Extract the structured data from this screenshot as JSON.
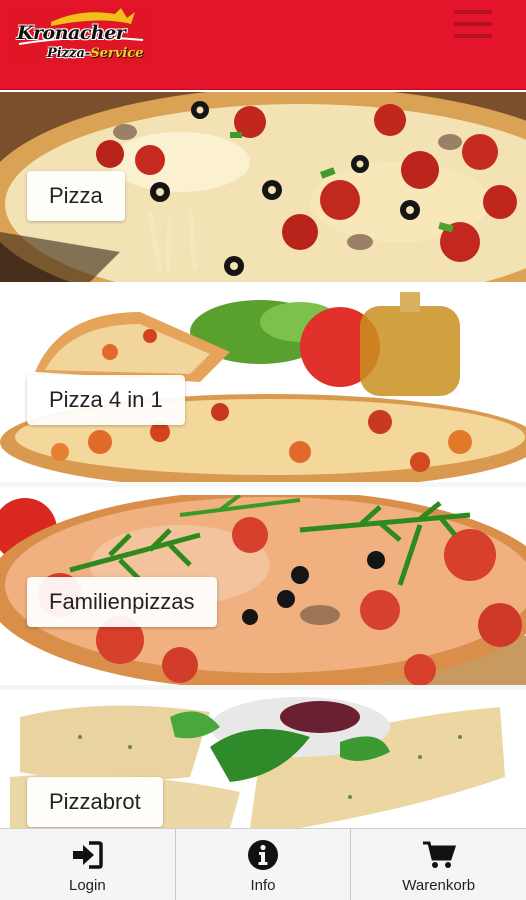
{
  "header": {
    "logo_name": "Kronacher",
    "logo_sub1": "Pizza-",
    "logo_sub2": "Service",
    "menu_icon": "hamburger-menu-icon",
    "color": "#e4142a"
  },
  "categories": [
    {
      "label": "Pizza"
    },
    {
      "label": "Pizza 4 in 1"
    },
    {
      "label": "Familienpizzas"
    },
    {
      "label": "Pizzabrot"
    }
  ],
  "bottom_nav": [
    {
      "label": "Login",
      "icon": "login-icon"
    },
    {
      "label": "Info",
      "icon": "info-icon"
    },
    {
      "label": "Warenkorb",
      "icon": "cart-icon"
    }
  ]
}
